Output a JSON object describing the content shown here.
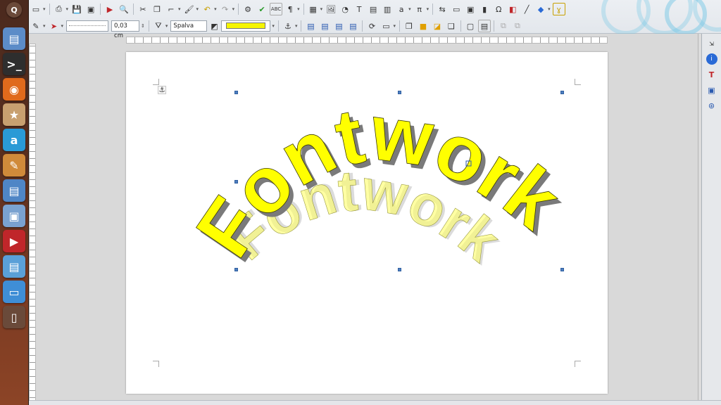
{
  "toolbar": {
    "line_width_value": "0,03 cm",
    "area_style_value": "Spalva",
    "fill_color": "#f5f500"
  },
  "fontwork": {
    "front_text": "Fontwork",
    "back_text": "Fontwork",
    "fill": "#ffff00",
    "shadow": "#808080",
    "outline": "#3a3a00"
  },
  "launcher": {
    "items": [
      {
        "icon": "ubuntu-dash-icon",
        "color": "#6b4a3a"
      },
      {
        "icon": "printer-icon",
        "color": "#5c8cc8"
      },
      {
        "icon": "terminal-icon",
        "color": "#2e2e2e"
      },
      {
        "icon": "firefox-icon",
        "color": "#e06a1c"
      },
      {
        "icon": "software-center-icon",
        "color": "#c8a070"
      },
      {
        "icon": "unity-a-icon",
        "color": "#2a9ad6"
      },
      {
        "icon": "paint-brush-icon",
        "color": "#d08a3a"
      },
      {
        "icon": "writer-icon",
        "color": "#4f86c6"
      },
      {
        "icon": "screenshot-icon",
        "color": "#7aa2d0"
      },
      {
        "icon": "pdf-icon",
        "color": "#c0262a"
      },
      {
        "icon": "files-icon",
        "color": "#5aa0d8"
      },
      {
        "icon": "workspace-icon",
        "color": "#3f8ed6"
      },
      {
        "icon": "trash-icon",
        "color": "#6a4a3a"
      }
    ]
  }
}
